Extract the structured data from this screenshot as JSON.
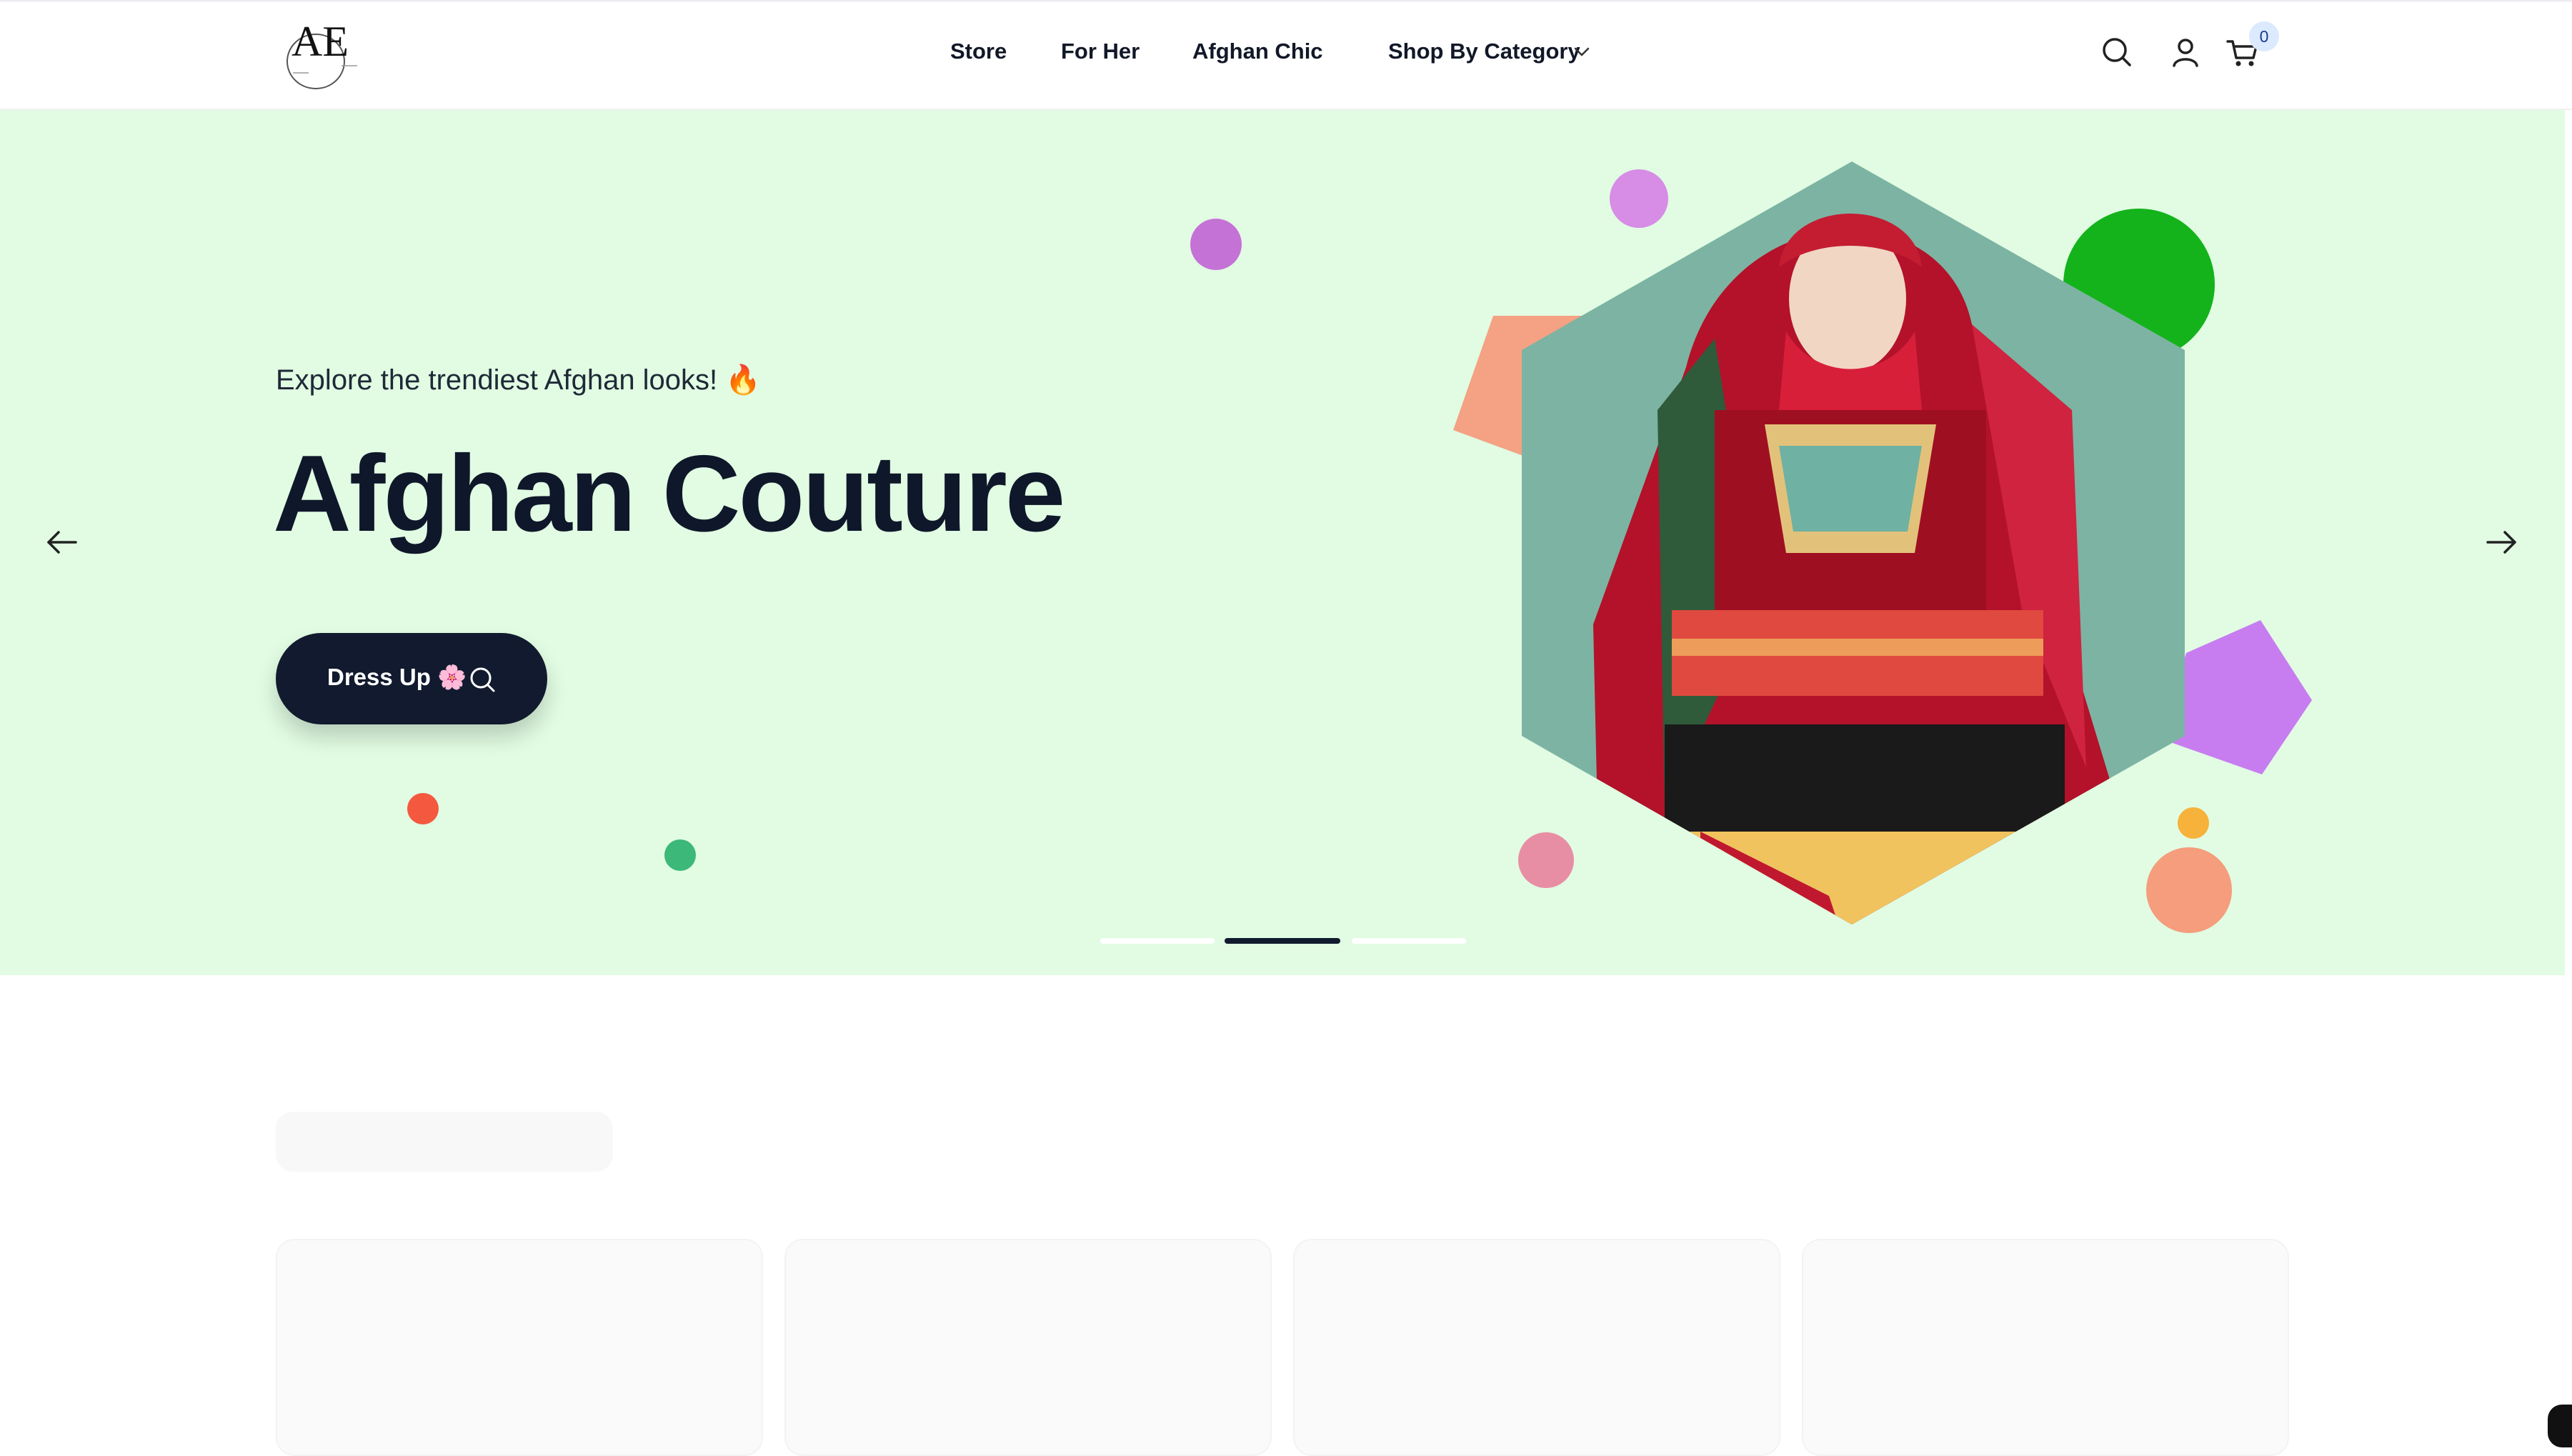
{
  "header": {
    "logo_text": "AE",
    "nav": [
      {
        "label": "Store"
      },
      {
        "label": "For Her"
      },
      {
        "label": "Afghan Chic"
      },
      {
        "label": "Shop By Category"
      }
    ],
    "icons": {
      "search": "search-icon",
      "account": "user-icon",
      "cart": "cart-icon",
      "dropdown": "chevron-down-icon"
    },
    "cart_count": "0"
  },
  "hero": {
    "subtitle": "Explore the trendiest Afghan looks! 🔥",
    "title": "Afghan Couture",
    "cta_label": "Dress Up 🌸",
    "cta_icon": "search-icon",
    "prev_icon": "arrow-left-icon",
    "next_icon": "arrow-right-icon",
    "slide_count": 3,
    "active_slide": 2,
    "image_alt": "Woman in traditional red embroidered Afghan dress",
    "colors": {
      "background": "#e1fce3",
      "hexagon": "#7db3a3",
      "cta": "#111a2e"
    }
  },
  "products": {
    "loading": true,
    "placeholder_cards": 4
  }
}
